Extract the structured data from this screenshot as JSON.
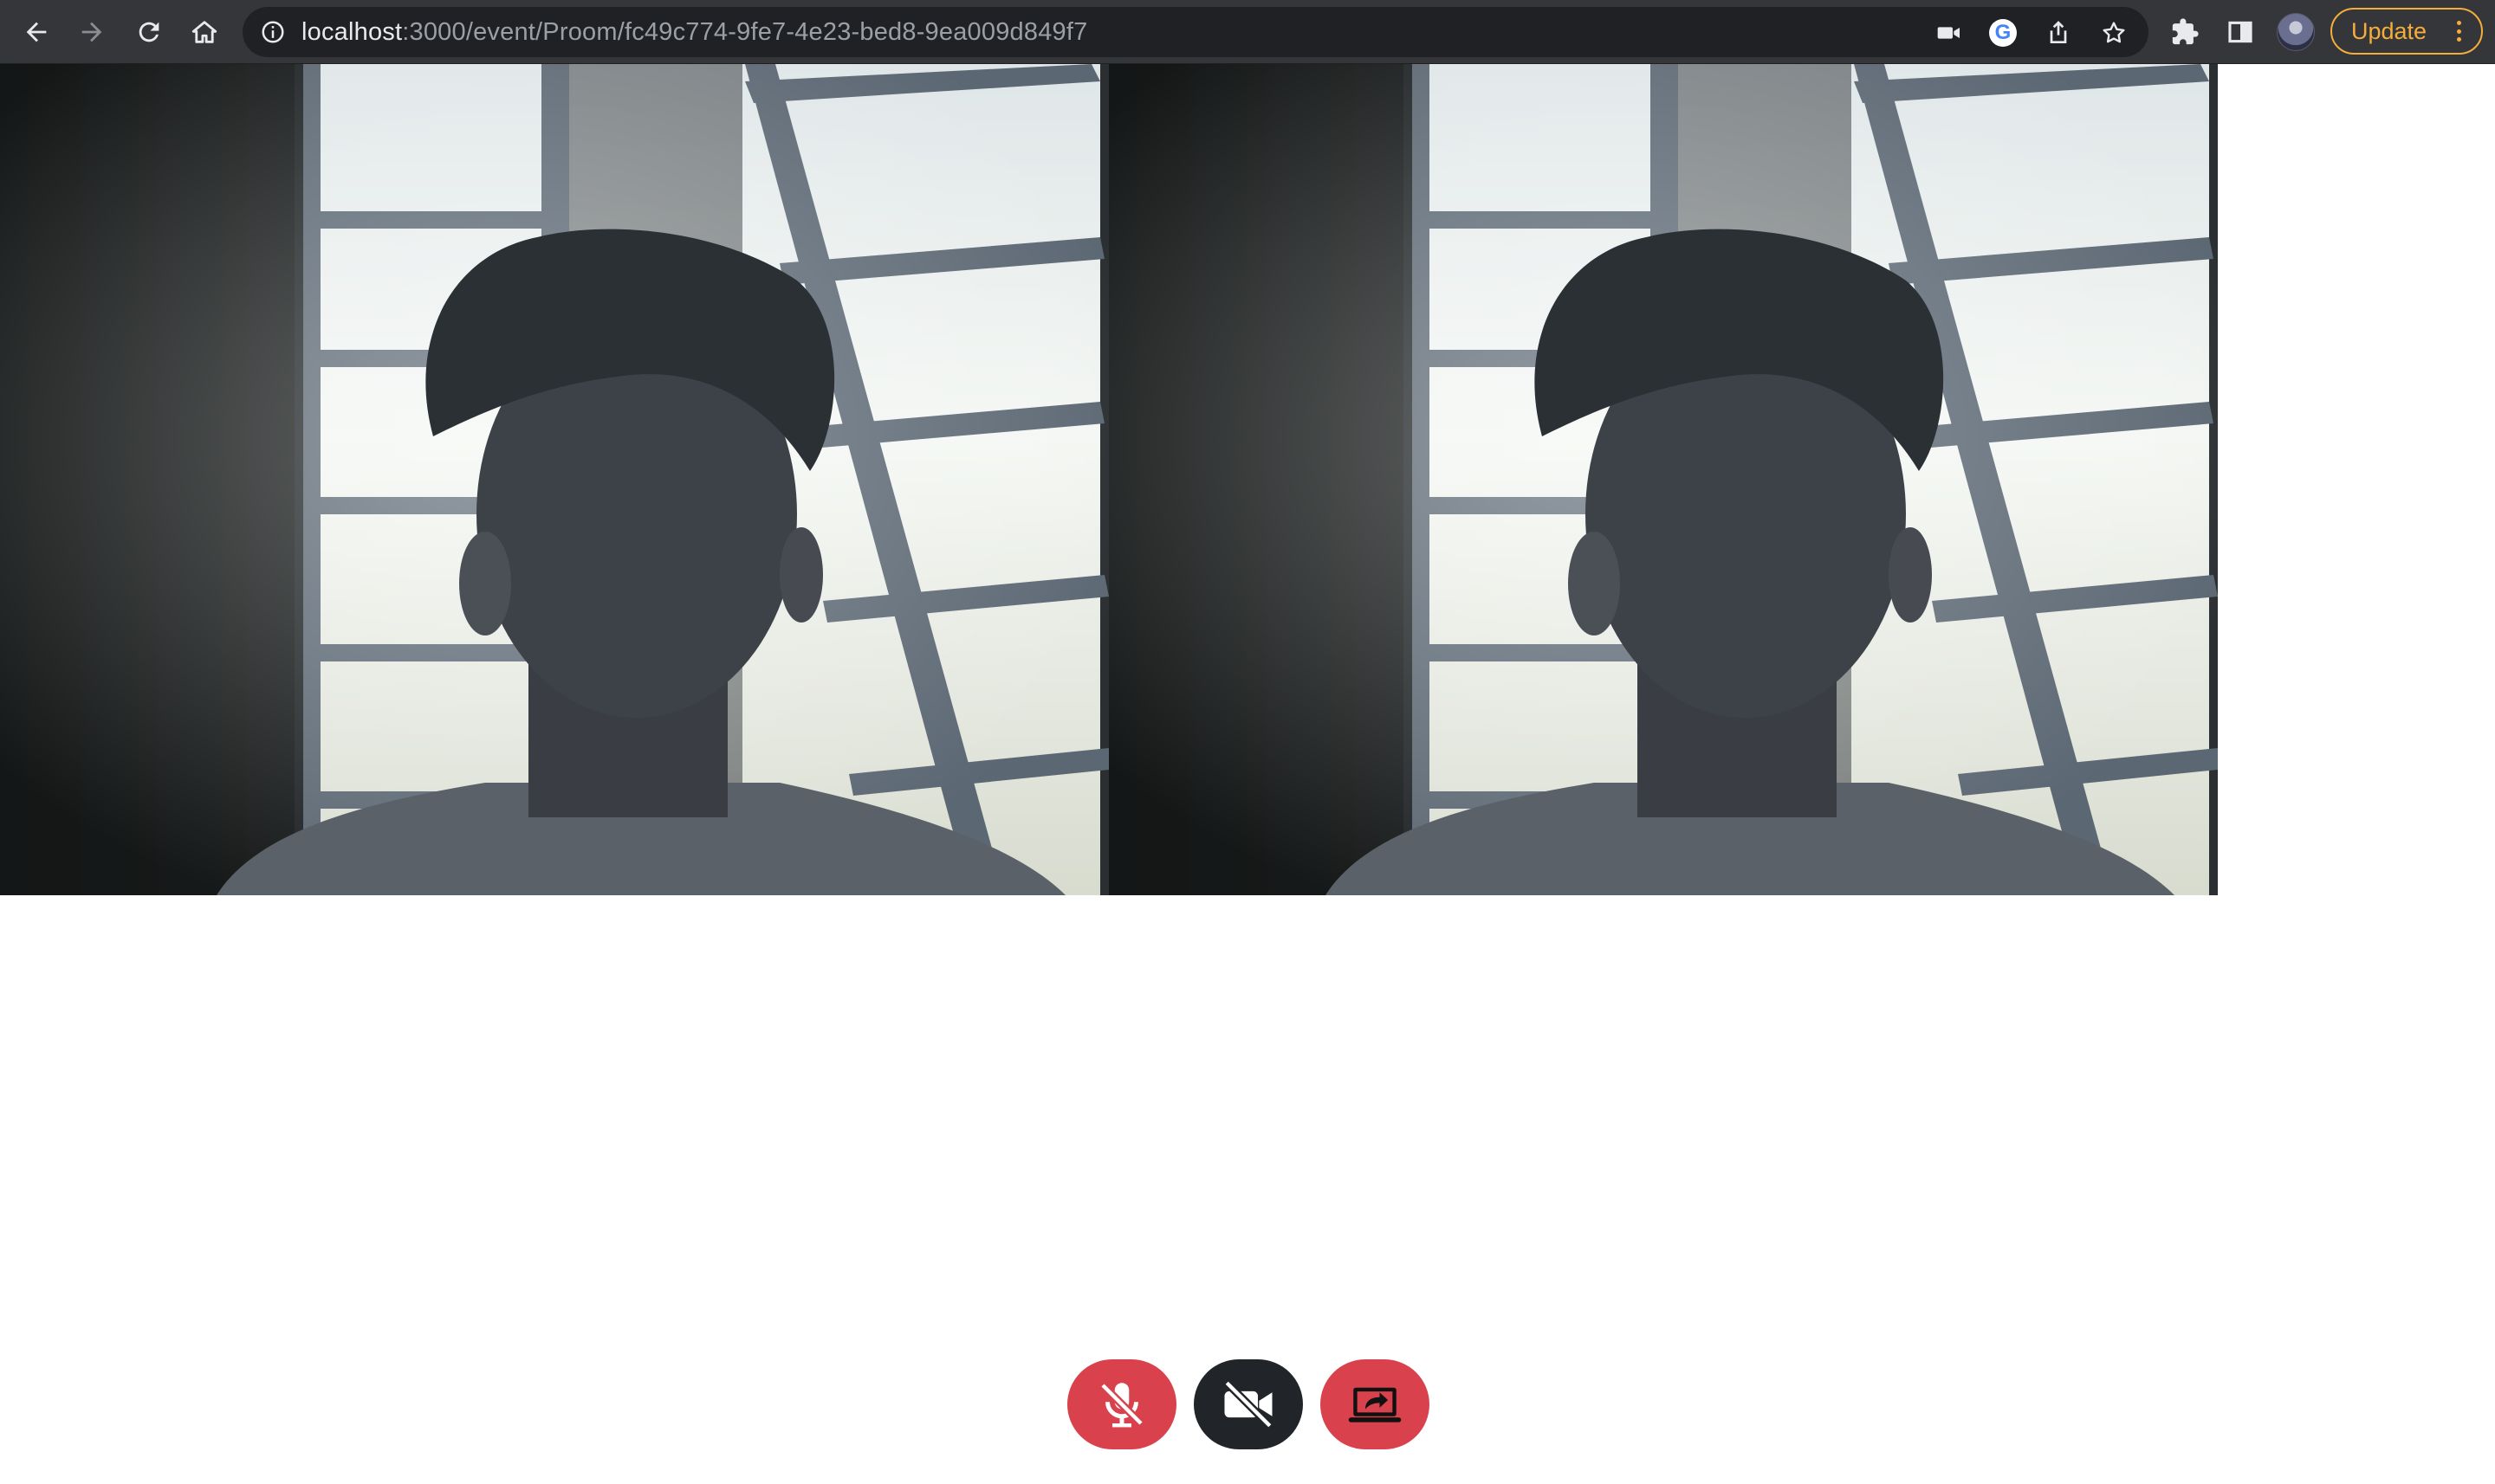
{
  "browser": {
    "url_host": "localhost",
    "url_path": ":3000/event/Proom/fc49c774-9fe7-4e23-bed8-9ea009d849f7",
    "update_label": "Update",
    "icons": [
      "back-icon",
      "forward-icon",
      "reload-icon",
      "home-icon",
      "site-info-icon",
      "camera-in-use-icon",
      "google-icon",
      "share-icon",
      "bookmark-star-icon",
      "extensions-icon",
      "side-panel-icon",
      "profile-avatar",
      "more-menu-icon"
    ]
  },
  "videos": [
    {
      "name": "local-video",
      "description": "webcam feed"
    },
    {
      "name": "remote-video",
      "description": "webcam feed"
    }
  ],
  "controls": [
    {
      "name": "mute-microphone-button",
      "icon": "mic-off-icon",
      "color": "#d9414c"
    },
    {
      "name": "toggle-camera-button",
      "icon": "video-off-icon",
      "color": "#212529"
    },
    {
      "name": "share-screen-button",
      "icon": "screen-share-icon",
      "color": "#d9414c"
    }
  ],
  "colors": {
    "accent_red": "#d9414c",
    "dark_button": "#212529",
    "update_orange": "#f6ae3a",
    "toolbar_bg": "#35363a"
  }
}
